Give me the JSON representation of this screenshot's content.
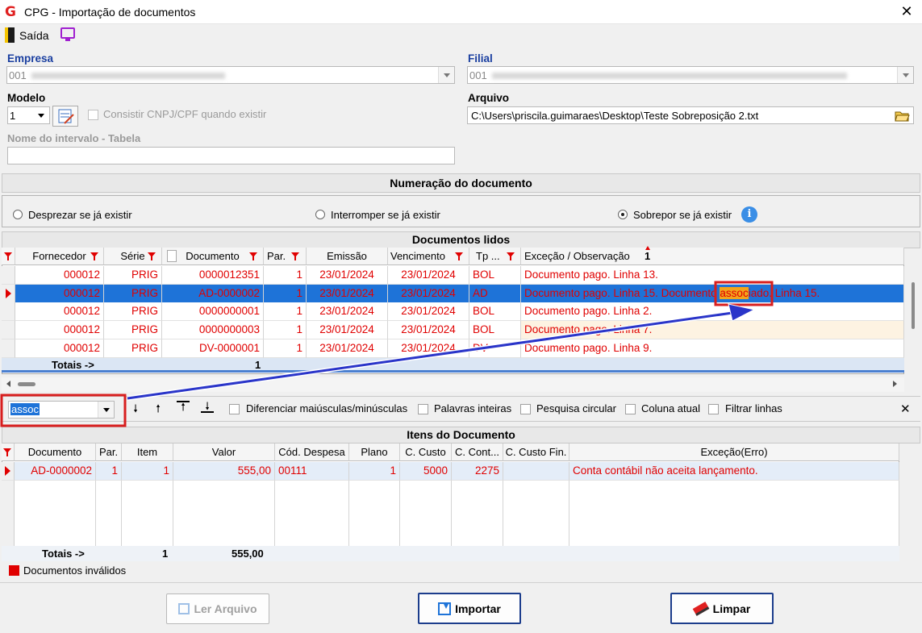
{
  "window": {
    "title": "CPG - Importação de documentos",
    "close": "✕"
  },
  "toolbar": {
    "exit_label": "Saída"
  },
  "form": {
    "empresa_label": "Empresa",
    "empresa_value": "001",
    "filial_label": "Filial",
    "filial_value": "001",
    "modelo_label": "Modelo",
    "modelo_value": "1",
    "consistir_label": "Consistir CNPJ/CPF quando existir",
    "arquivo_label": "Arquivo",
    "arquivo_value": "C:\\Users\\priscila.guimaraes\\Desktop\\Teste Sobreposição 2.txt",
    "intervalo_label": "Nome do intervalo - Tabela",
    "intervalo_value": ""
  },
  "numeracao": {
    "title": "Numeração do documento",
    "options": [
      "Desprezar se já existir",
      "Interromper se já existir",
      "Sobrepor se já existir"
    ],
    "selected": "Sobrepor se já existir"
  },
  "docs": {
    "title": "Documentos lidos",
    "headers": [
      "Fornecedor",
      "Série",
      "Documento",
      "Par.",
      "Emissão",
      "Vencimento",
      "Tp ...",
      "Exceção / Observação"
    ],
    "rows": [
      [
        "000012",
        "PRIG",
        "0000012351",
        "1",
        "23/01/2024",
        "23/01/2024",
        "BOL",
        "Documento pago. Linha 13."
      ],
      [
        "000012",
        "PRIG",
        "AD-0000002",
        "1",
        "23/01/2024",
        "23/01/2024",
        "AD",
        "Documento pago. Linha 15. Documento associado. Linha 15."
      ],
      [
        "000012",
        "PRIG",
        "0000000001",
        "1",
        "23/01/2024",
        "23/01/2024",
        "BOL",
        "Documento pago. Linha 2."
      ],
      [
        "000012",
        "PRIG",
        "0000000003",
        "1",
        "23/01/2024",
        "23/01/2024",
        "BOL",
        "Documento pago. Linha 7."
      ],
      [
        "000012",
        "PRIG",
        "DV-0000001",
        "1",
        "23/01/2024",
        "23/01/2024",
        "DV",
        "Documento pago. Linha 9."
      ]
    ],
    "selected_row": 1,
    "totals_label": "Totais ->",
    "totals_count": "1",
    "sort_marker": "1"
  },
  "search": {
    "value": "assoc",
    "options": [
      "Diferenciar maiúsculas/minúsculas",
      "Palavras inteiras",
      "Pesquisa circular",
      "Coluna atual",
      "Filtrar linhas"
    ]
  },
  "items": {
    "title": "Itens do Documento",
    "headers": [
      "Documento",
      "Par.",
      "Item",
      "Valor",
      "Cód. Despesa",
      "Plano",
      "C. Custo",
      "C. Cont...",
      "C. Custo Fin.",
      "Exceção(Erro)"
    ],
    "rows": [
      [
        "AD-0000002",
        "1",
        "1",
        "555,00",
        "00111",
        "1",
        "5000",
        "2275",
        "",
        "Conta contábil não aceita lançamento."
      ]
    ],
    "totals_label": "Totais ->",
    "totals_item": "1",
    "totals_valor": "555,00"
  },
  "legend": {
    "invalid_docs": "Documentos inválidos"
  },
  "buttons": {
    "ler": "Ler Arquivo",
    "importar": "Importar",
    "limpar": "Limpar"
  },
  "colors": {
    "error_red": "#e00000",
    "selection_blue": "#1e73d8",
    "highlight_orange": "#f2a31b",
    "annotation_red": "#d81e1e",
    "arrow_blue": "#2a35c9"
  },
  "icons": [
    "app-logo-icon",
    "exit-door-icon",
    "screen-icon",
    "edit-model-icon",
    "open-folder-icon",
    "info-icon",
    "filter-icon",
    "import-icon",
    "eraser-icon",
    "copy-icon"
  ]
}
